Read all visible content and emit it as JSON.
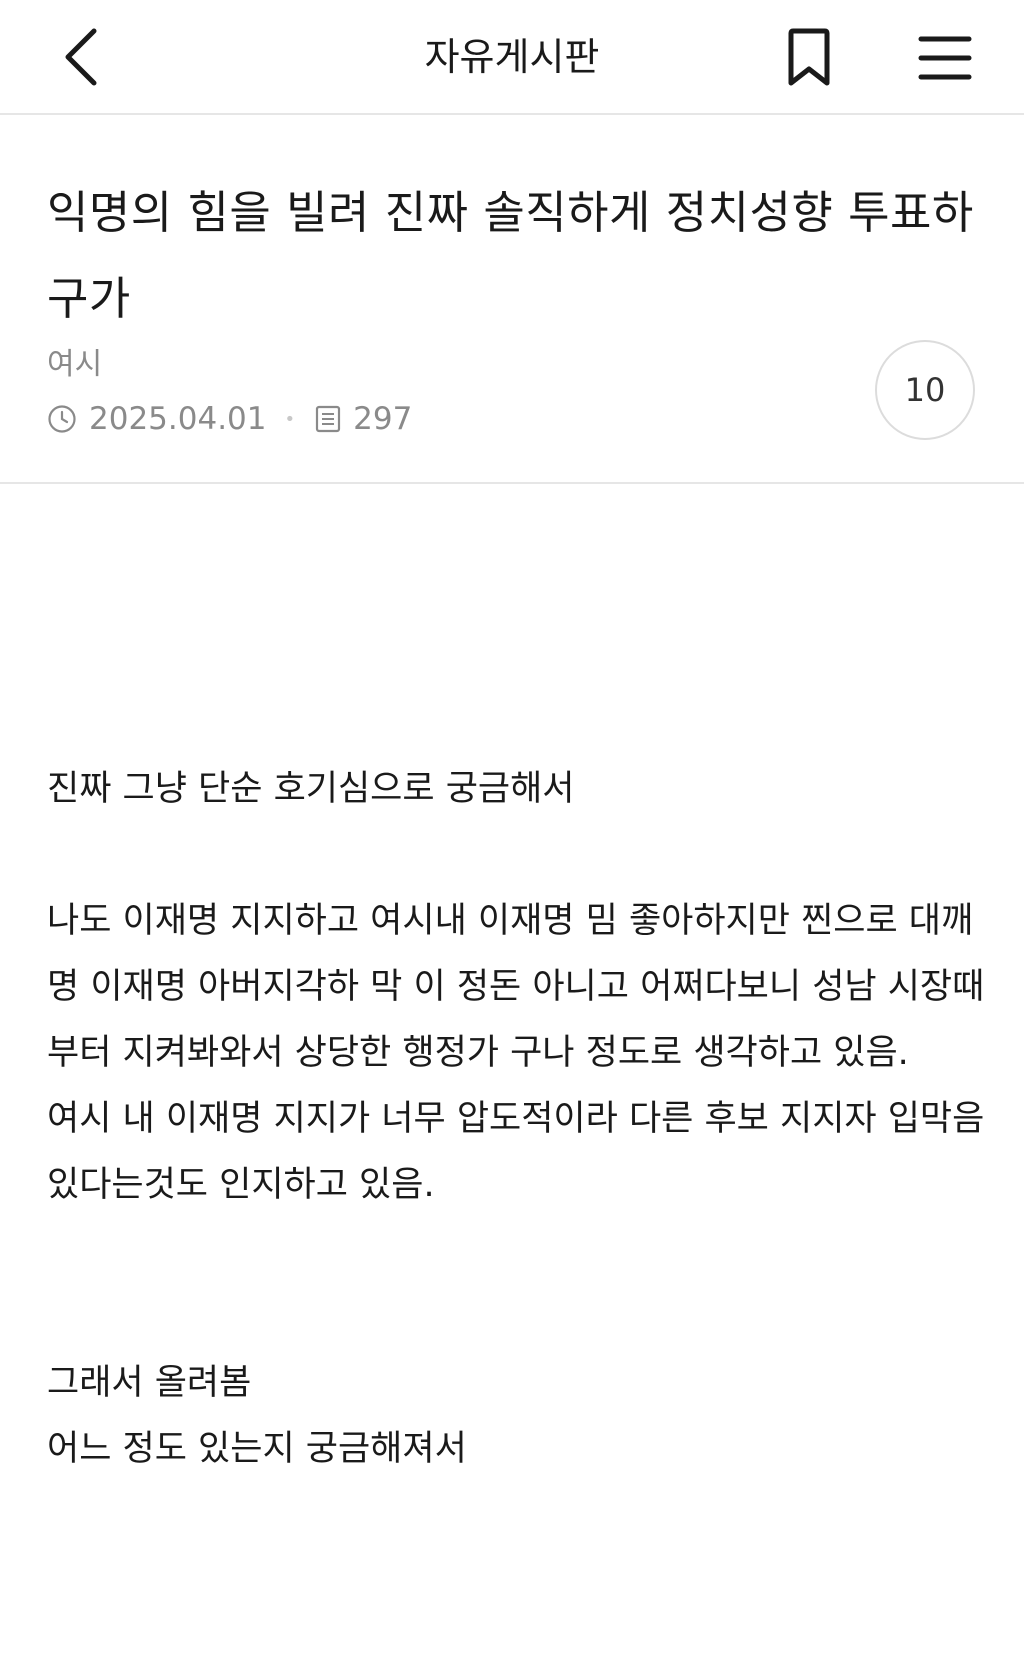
{
  "header": {
    "title": "자유게시판"
  },
  "post": {
    "title": "익명의 힘을 빌려 진짜 솔직하게 정치성향 투표하구가",
    "author": "여시",
    "date": "2025.04.01",
    "views": "297",
    "comment_count": "10"
  },
  "content": {
    "p1": "진짜 그냥 단순 호기심으로 궁금해서",
    "p2": "나도 이재명 지지하고 여시내 이재명 밈 좋아하지만 찐으로 대깨명 이재명 아버지각하 막 이 정돈 아니고 어쩌다보니 성남 시장때부터 지켜봐와서 상당한 행정가 구나 정도로 생각하고 있음.\n여시 내 이재명 지지가 너무 압도적이라 다른 후보 지지자 입막음 있다는것도 인지하고 있음.",
    "p3": "그래서 올려봄\n어느 정도 있는지 궁금해져서"
  },
  "icons": {
    "back": "chevron-left-icon",
    "bookmark": "bookmark-icon",
    "menu": "hamburger-menu-icon",
    "clock": "clock-icon",
    "views": "document-icon"
  },
  "colors": {
    "text": "#1a1a1a",
    "meta": "#8a8a8a",
    "divider": "#e6e6e6"
  }
}
